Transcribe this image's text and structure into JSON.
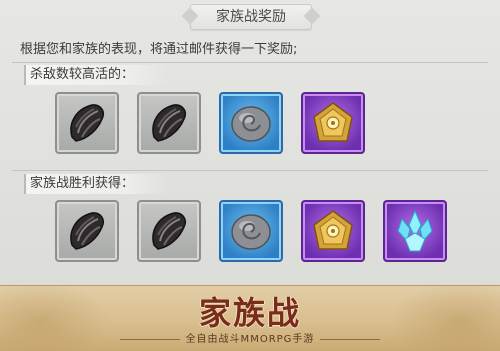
{
  "panel": {
    "title": "家族战奖励",
    "description": "根据您和家族的表现，将通过邮件获得一下奖励;",
    "sections": [
      {
        "label": "杀敌数较高活的：",
        "items": [
          {
            "icon": "dark-claw-icon",
            "rarity": "gray"
          },
          {
            "icon": "dark-claw-icon",
            "rarity": "gray"
          },
          {
            "icon": "spiral-stone-icon",
            "rarity": "blue"
          },
          {
            "icon": "gold-emblem-icon",
            "rarity": "purple"
          }
        ]
      },
      {
        "label": "家族战胜利获得：",
        "items": [
          {
            "icon": "dark-claw-icon",
            "rarity": "gray"
          },
          {
            "icon": "dark-claw-icon",
            "rarity": "gray"
          },
          {
            "icon": "spiral-stone-icon",
            "rarity": "blue"
          },
          {
            "icon": "gold-emblem-icon",
            "rarity": "purple"
          },
          {
            "icon": "blue-crystal-icon",
            "rarity": "purple"
          }
        ]
      }
    ]
  },
  "banner": {
    "title": "家族战",
    "subtitle": "全自由战斗MMORPG手游"
  },
  "colors": {
    "panel_bg": "#dfe0dc",
    "gray_slot": "#a8aaa7",
    "blue_slot": "#2f7fc4",
    "purple_slot": "#6b2fb0",
    "banner_bg": "#d9bf8f",
    "banner_title": "#7a2c1c"
  }
}
